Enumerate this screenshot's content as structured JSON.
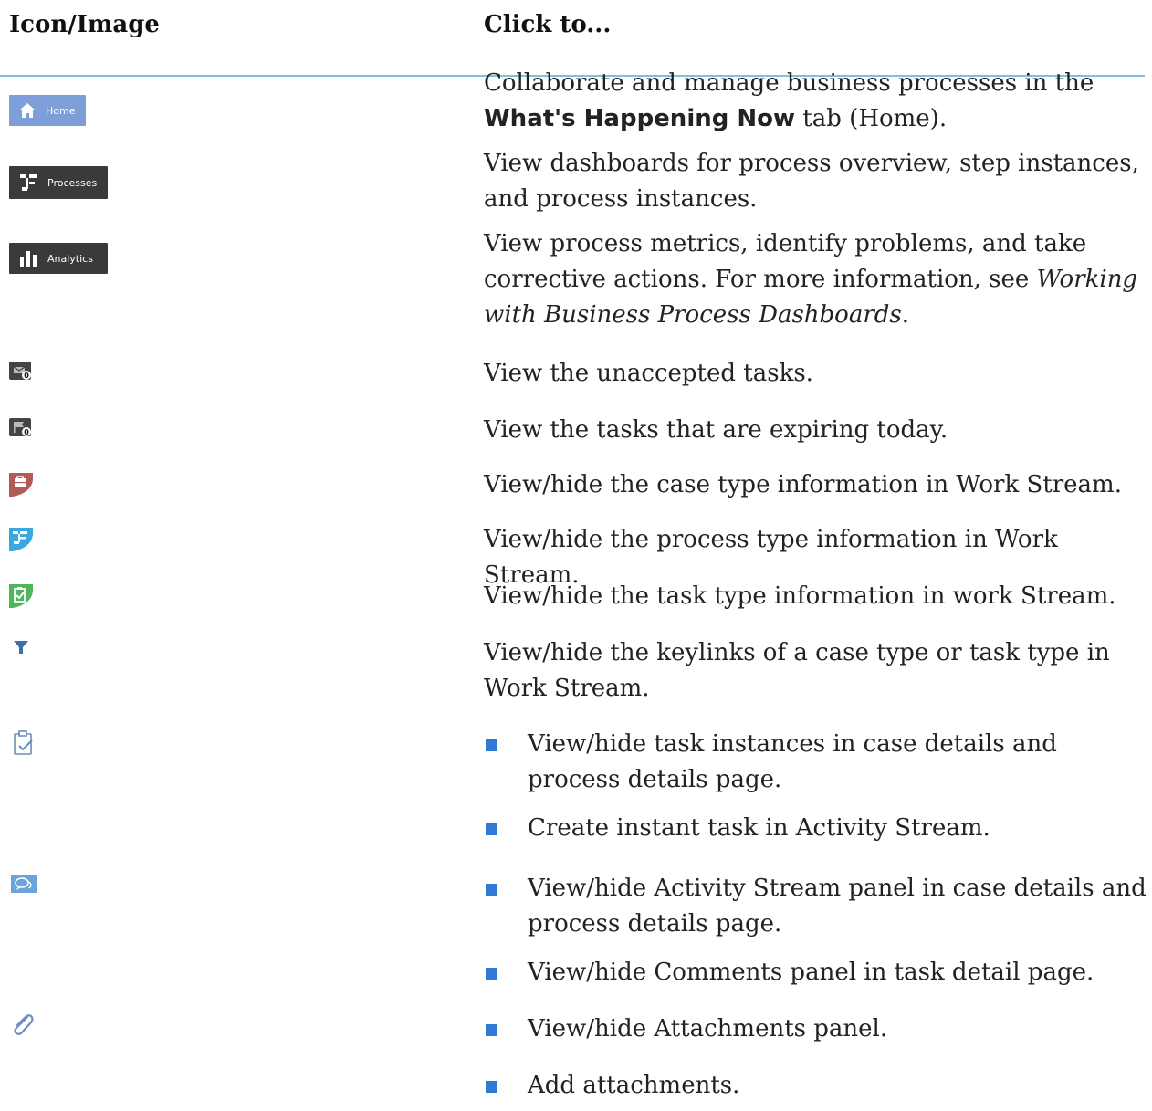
{
  "header": {
    "col1": "Icon/Image",
    "col2": "Click to..."
  },
  "buttons": {
    "home": "Home",
    "processes": "Processes",
    "analytics": "Analytics"
  },
  "rows": {
    "home": {
      "pre": "Collaborate and manage business processes in the ",
      "bold": "What's Happening Now",
      "post": " tab (Home)."
    },
    "processes": "View dashboards for process overview, step instances, and process instances.",
    "analytics": {
      "pre": "View process metrics, identify problems, and take corrective actions. For more information, see ",
      "italic": "Working with Business Process Dashboards",
      "post": "."
    },
    "unaccepted": "View the unaccepted tasks.",
    "expiring": "View the tasks that are expiring today.",
    "case_type": "View/hide the case type information in Work Stream.",
    "process_type": "View/hide the process type information in Work Stream.",
    "task_type": "View/hide the task type information in work Stream.",
    "keylinks": "View/hide the keylinks of a case type or task type in Work Stream.",
    "task_bullets": [
      "View/hide task instances in case details and process details page.",
      "Create instant task in Activity Stream."
    ],
    "activity_bullets": [
      "View/hide Activity Stream panel in case details and process details page.",
      "View/hide Comments panel in task detail page."
    ],
    "attach_bullets": [
      "View/hide Attachments panel.",
      "Add attachments."
    ]
  },
  "badges": {
    "unaccepted": "0",
    "expiring": "0"
  },
  "colors": {
    "home_btn": "#7b9fd6",
    "dark_btn": "#3a3a3a",
    "case": "#b05a5a",
    "process": "#3aa8e0",
    "task": "#4fb55a",
    "bullet": "#2f7ad4",
    "rule": "#7ec0e0"
  }
}
